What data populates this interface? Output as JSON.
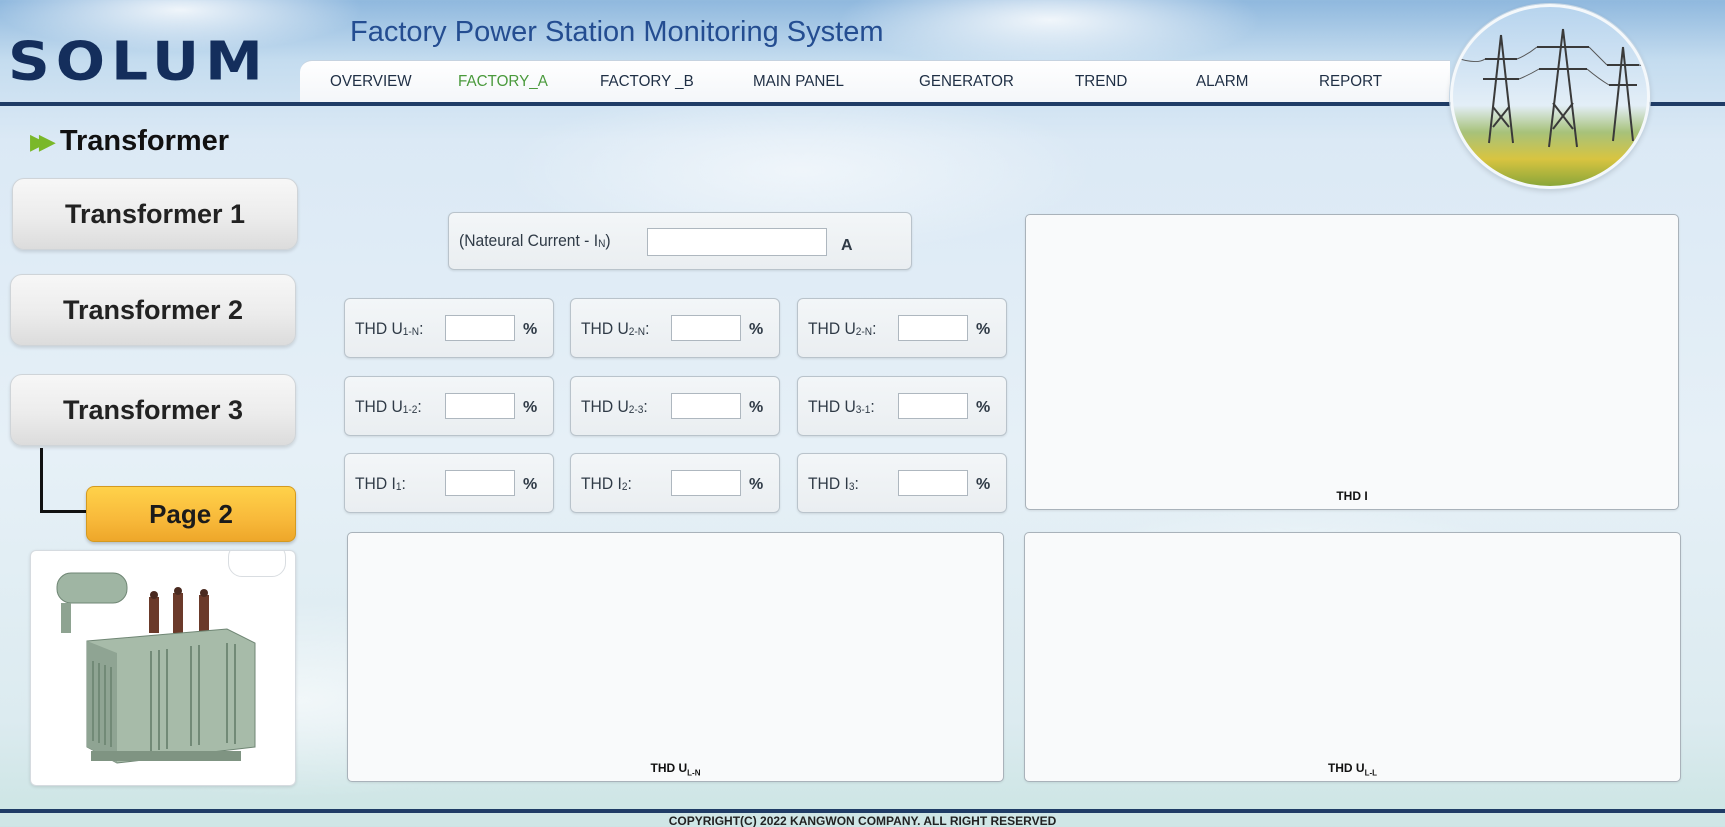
{
  "header": {
    "logo_text": "SOLUM",
    "app_title": "Factory Power Station Monitoring System"
  },
  "nav": {
    "items": [
      {
        "label": "OVERVIEW",
        "active": false
      },
      {
        "label": "FACTORY_A",
        "active": true
      },
      {
        "label": "FACTORY _B",
        "active": false
      },
      {
        "label": "MAIN PANEL",
        "active": false
      },
      {
        "label": "GENERATOR",
        "active": false
      },
      {
        "label": "TREND",
        "active": false
      },
      {
        "label": "ALARM",
        "active": false
      },
      {
        "label": "REPORT",
        "active": false
      }
    ],
    "active_color": "#4a9a3c"
  },
  "sidebar": {
    "heading": "Transformer",
    "buttons": [
      {
        "label": "Transformer 1"
      },
      {
        "label": "Transformer 2"
      },
      {
        "label": "Transformer 3"
      }
    ],
    "subpage_label": "Page 2"
  },
  "measurements": {
    "neutral": {
      "label_main": "(Nateural Current - I",
      "label_sub": "N",
      "label_end": ")",
      "value": "",
      "unit": "A"
    },
    "rows": [
      [
        {
          "label_main": "THD U",
          "label_sub": "1-N",
          "value": "",
          "unit": "%"
        },
        {
          "label_main": "THD U",
          "label_sub": "2-N",
          "value": "",
          "unit": "%"
        },
        {
          "label_main": "THD U",
          "label_sub": "2-N",
          "value": "",
          "unit": "%"
        }
      ],
      [
        {
          "label_main": "THD U",
          "label_sub": "1-2",
          "value": "",
          "unit": "%"
        },
        {
          "label_main": "THD U",
          "label_sub": "2-3",
          "value": "",
          "unit": "%"
        },
        {
          "label_main": "THD U",
          "label_sub": "3-1",
          "value": "",
          "unit": "%"
        }
      ],
      [
        {
          "label_main": "THD I",
          "label_sub": "1",
          "value": "",
          "unit": "%"
        },
        {
          "label_main": "THD I",
          "label_sub": "2",
          "value": "",
          "unit": "%"
        },
        {
          "label_main": "THD I",
          "label_sub": "3",
          "value": "",
          "unit": "%"
        }
      ]
    ],
    "colon": ":"
  },
  "charts": {
    "thd_i": {
      "title_main": "THD I",
      "title_sub": ""
    },
    "thd_uln": {
      "title_main": "THD U",
      "title_sub": "L-N"
    },
    "thd_ull": {
      "title_main": "THD U",
      "title_sub": "L-L"
    }
  },
  "footer": {
    "copyright": "COPYRIGHT(C) 2022 KANGWON COMPANY. ALL RIGHT RESERVED"
  },
  "colors": {
    "brand_navy": "#142e5c",
    "title_blue": "#244d91",
    "page_button": "#f8b93a",
    "heading_arrow": "#7ab829"
  }
}
